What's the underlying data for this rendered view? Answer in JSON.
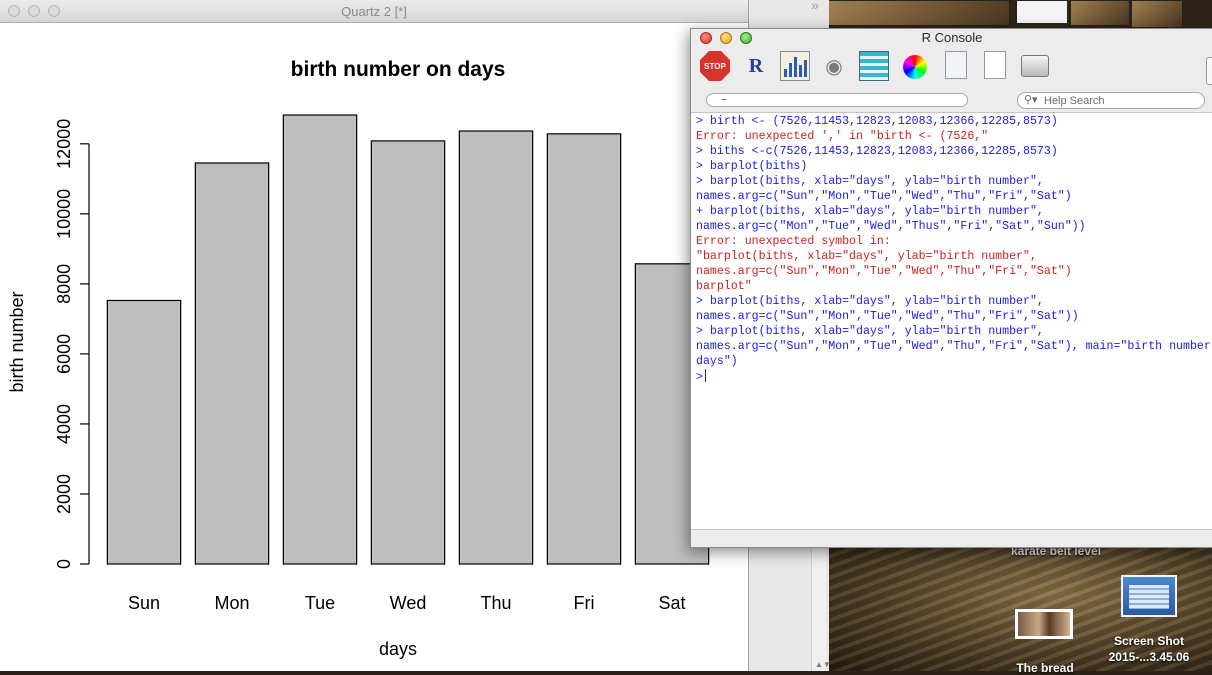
{
  "quartz": {
    "title": "Quartz 2 [*]"
  },
  "chart_data": {
    "type": "bar",
    "title": "birth number on days",
    "xlabel": "days",
    "ylabel": "birth number",
    "categories": [
      "Sun",
      "Mon",
      "Tue",
      "Wed",
      "Thu",
      "Fri",
      "Sat"
    ],
    "values": [
      7526,
      11453,
      12823,
      12083,
      12366,
      12285,
      8573
    ],
    "yticks": [
      0,
      2000,
      4000,
      6000,
      8000,
      10000,
      12000
    ],
    "ylim": [
      0,
      12823
    ],
    "bar_color": "#bebebe",
    "grid": false
  },
  "rconsole": {
    "title": "R Console",
    "toolbar": [
      "stop-icon",
      "r-source-icon",
      "chart-icon",
      "lock-icon",
      "list-icon",
      "color-wheel-icon",
      "open-doc-icon",
      "new-doc-icon",
      "print-icon"
    ],
    "dir_value": "~",
    "help_placeholder": "Help Search",
    "colors": {
      "input": "#1a1ae6",
      "error": "#d41c1c"
    },
    "lines": [
      {
        "type": "in",
        "text": "> birth <- (7526,11453,12823,12083,12366,12285,8573)"
      },
      {
        "type": "err",
        "text": "Error: unexpected ',' in \"birth <- (7526,\""
      },
      {
        "type": "in",
        "text": "> biths <-c(7526,11453,12823,12083,12366,12285,8573)"
      },
      {
        "type": "in",
        "text": "> barplot(biths)"
      },
      {
        "type": "in",
        "text": "> barplot(biths, xlab=\"days\", ylab=\"birth number\","
      },
      {
        "type": "in",
        "text": "names.arg=c(\"Sun\",\"Mon\",\"Tue\",\"Wed\",\"Thu\",\"Fri\",\"Sat\")"
      },
      {
        "type": "in",
        "text": "+ barplot(biths, xlab=\"days\", ylab=\"birth number\","
      },
      {
        "type": "in",
        "text": "names.arg=c(\"Mon\",\"Tue\",\"Wed\",\"Thus\",\"Fri\",\"Sat\",\"Sun\"))"
      },
      {
        "type": "err",
        "text": "Error: unexpected symbol in:"
      },
      {
        "type": "err",
        "text": "\"barplot(biths, xlab=\"days\", ylab=\"birth number\","
      },
      {
        "type": "err",
        "text": "names.arg=c(\"Sun\",\"Mon\",\"Tue\",\"Wed\",\"Thu\",\"Fri\",\"Sat\")"
      },
      {
        "type": "err",
        "text": "barplot\""
      },
      {
        "type": "in",
        "text": "> barplot(biths, xlab=\"days\", ylab=\"birth number\","
      },
      {
        "type": "in",
        "text": "names.arg=c(\"Sun\",\"Mon\",\"Tue\",\"Wed\",\"Thu\",\"Fri\",\"Sat\"))"
      },
      {
        "type": "in",
        "text": "> barplot(biths, xlab=\"days\", ylab=\"birth number\","
      },
      {
        "type": "in",
        "text": "names.arg=c(\"Sun\",\"Mon\",\"Tue\",\"Wed\",\"Thu\",\"Fri\",\"Sat\"), main=\"birth number on"
      },
      {
        "type": "in",
        "text": "days\")"
      }
    ],
    "prompt": ">"
  },
  "desktop": {
    "label_karate": "karate belt level",
    "label_screenshot_1": "Screen Shot",
    "label_screenshot_2": "2015-...3.45.06",
    "label_bread": "The bread"
  }
}
